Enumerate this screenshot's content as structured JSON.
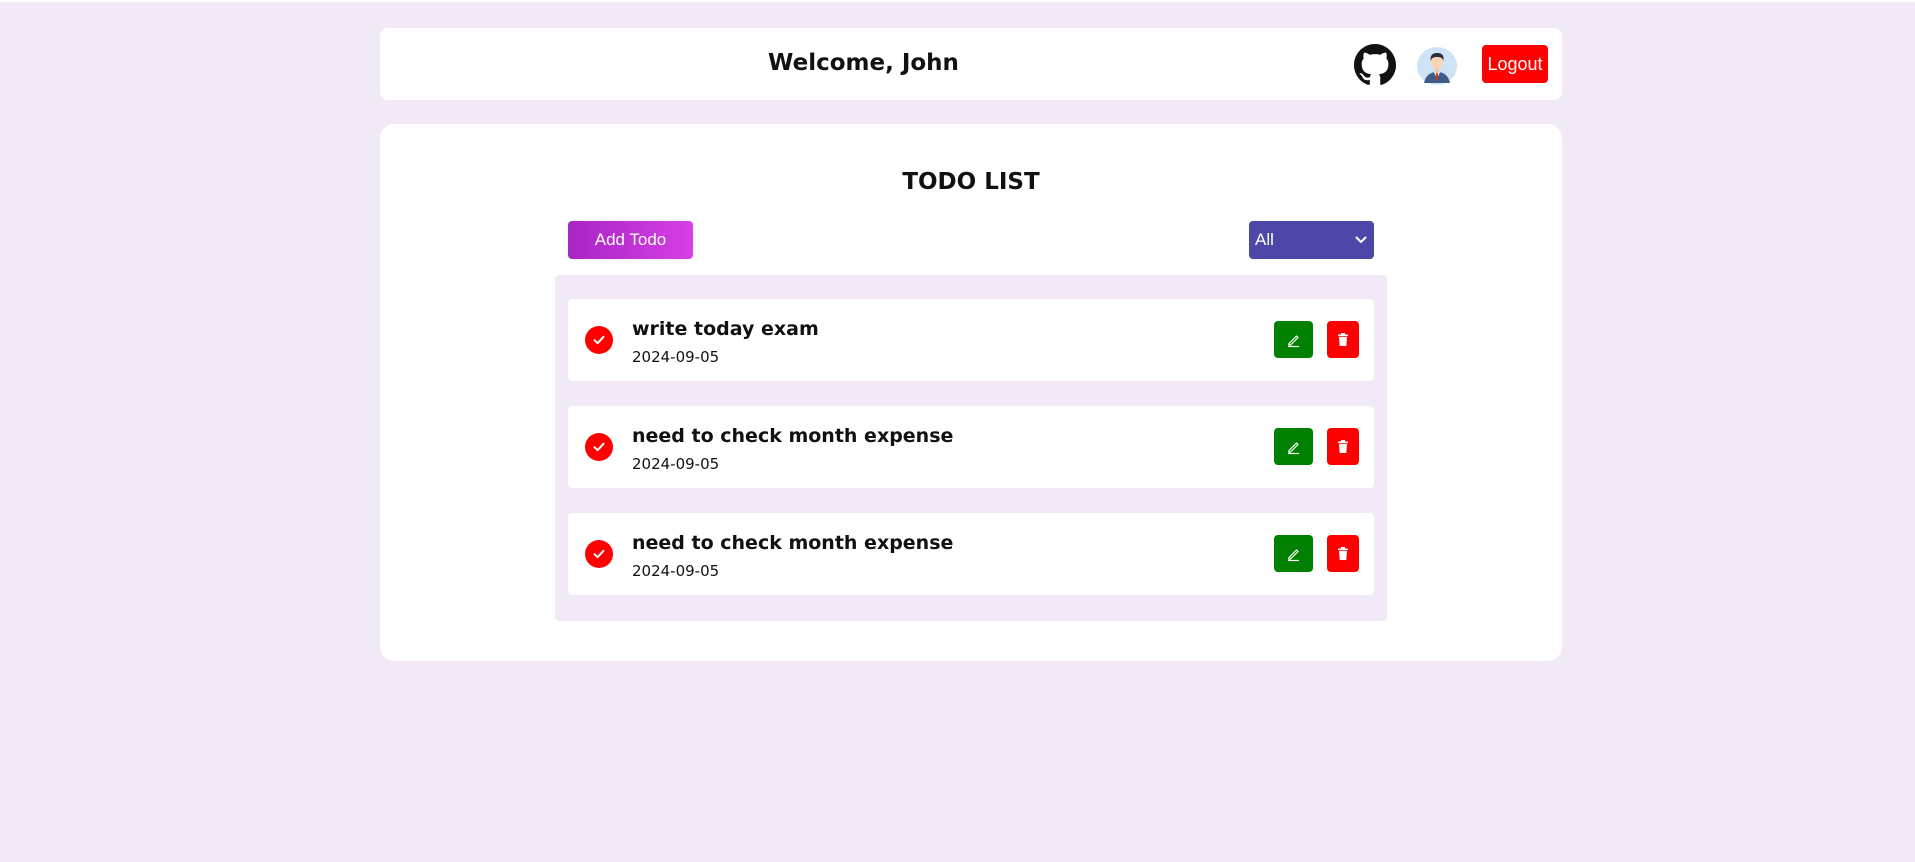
{
  "header": {
    "welcome": "Welcome, John",
    "logout_label": "Logout"
  },
  "main": {
    "title": "TODO LIST",
    "add_label": "Add Todo",
    "filter": {
      "selected": "All"
    },
    "todos": [
      {
        "title": "write today exam",
        "date": "2024-09-05"
      },
      {
        "title": "need to check month expense",
        "date": "2024-09-05"
      },
      {
        "title": "need to check month expense",
        "date": "2024-09-05"
      }
    ]
  },
  "colors": {
    "background": "#f1e9f6",
    "accent_purple": "#a825c4",
    "filter_blue": "#4e46a8",
    "danger_red": "#ff0000",
    "edit_green": "#008000"
  },
  "icons": {
    "github": "github-icon",
    "avatar": "user-avatar",
    "check": "check-icon",
    "edit": "pencil-icon",
    "delete": "trash-icon",
    "dropdown": "chevron-down-icon"
  }
}
